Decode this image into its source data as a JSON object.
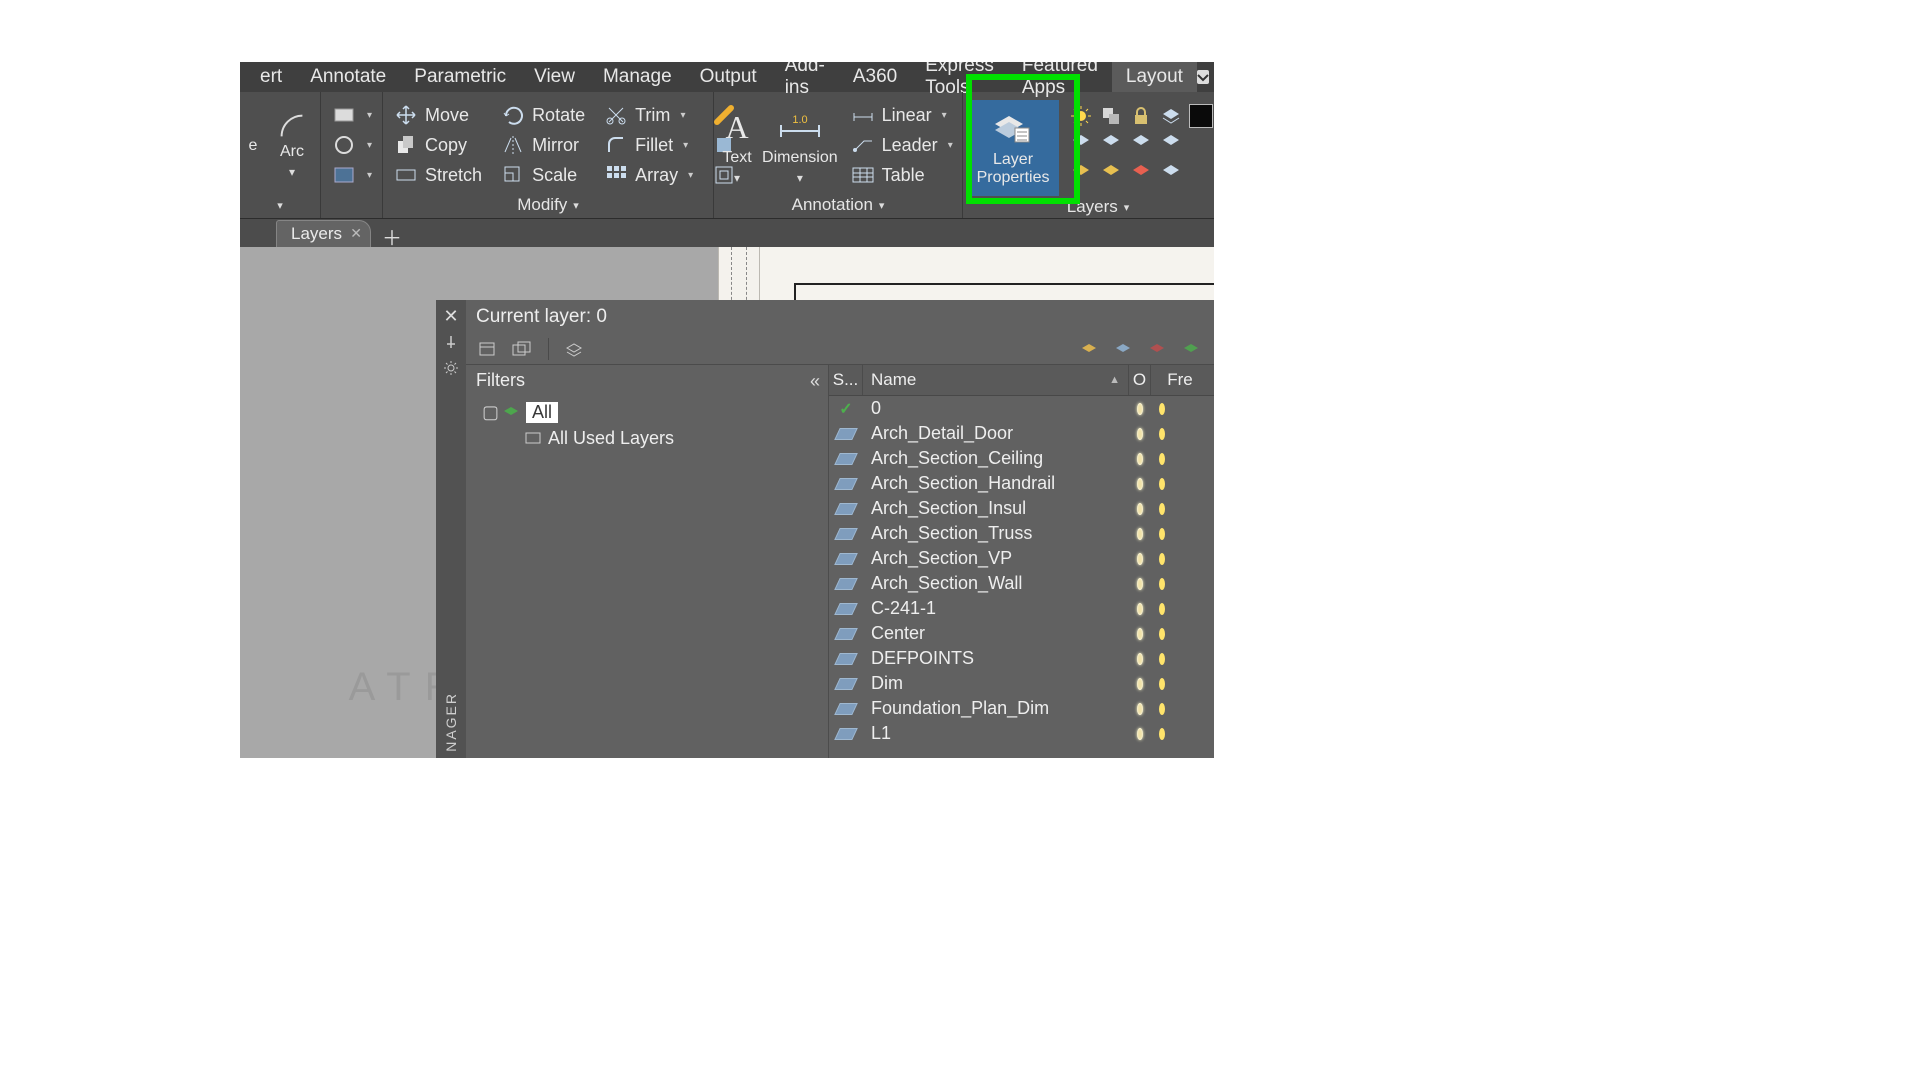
{
  "menubar": {
    "items": [
      "ert",
      "Annotate",
      "Parametric",
      "View",
      "Manage",
      "Output",
      "Add-ins",
      "A360",
      "Express Tools",
      "Featured Apps",
      "Layout"
    ],
    "active_index": 10
  },
  "ribbon": {
    "draw": {
      "arc": "Arc",
      "line": "e",
      "label": ""
    },
    "modify": {
      "move": "Move",
      "copy": "Copy",
      "stretch": "Stretch",
      "rotate": "Rotate",
      "mirror": "Mirror",
      "scale": "Scale",
      "trim": "Trim",
      "fillet": "Fillet",
      "array": "Array",
      "label": "Modify"
    },
    "annotation": {
      "text": "Text",
      "dimension": "Dimension",
      "linear": "Linear",
      "leader": "Leader",
      "table": "Table",
      "label": "Annotation"
    },
    "layers": {
      "layerprops_line1": "Layer",
      "layerprops_line2": "Properties",
      "label": "Layers",
      "current": "0"
    }
  },
  "tabs": {
    "active": "Layers"
  },
  "layer_manager": {
    "title": "Current layer: 0",
    "vertical_label": "NAGER",
    "filters_label": "Filters",
    "tree": {
      "root": "All",
      "child": "All Used Layers"
    },
    "columns": {
      "status": "S...",
      "name": "Name",
      "on": "O",
      "freeze": "Fre"
    },
    "rows": [
      {
        "name": "0",
        "current": true
      },
      {
        "name": "Arch_Detail_Door"
      },
      {
        "name": "Arch_Section_Ceiling"
      },
      {
        "name": "Arch_Section_Handrail"
      },
      {
        "name": "Arch_Section_Insul"
      },
      {
        "name": "Arch_Section_Truss"
      },
      {
        "name": "Arch_Section_VP"
      },
      {
        "name": "Arch_Section_Wall"
      },
      {
        "name": "C-241-1"
      },
      {
        "name": "Center"
      },
      {
        "name": "DEFPOINTS"
      },
      {
        "name": "Dim"
      },
      {
        "name": "Foundation_Plan_Dim"
      },
      {
        "name": "L1"
      }
    ]
  },
  "watermark": "ATRO ACADEMY"
}
